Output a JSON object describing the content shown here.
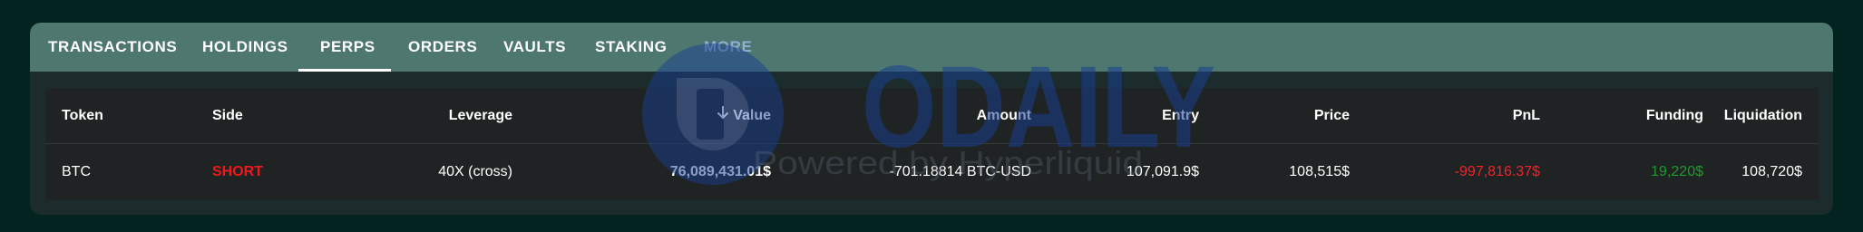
{
  "tabs": [
    {
      "label": "TRANSACTIONS"
    },
    {
      "label": "HOLDINGS"
    },
    {
      "label": "PERPS"
    },
    {
      "label": "ORDERS"
    },
    {
      "label": "VAULTS"
    },
    {
      "label": "STAKING"
    },
    {
      "label": "MORE"
    }
  ],
  "active_tab": "PERPS",
  "table": {
    "headers": {
      "token": "Token",
      "side": "Side",
      "leverage": "Leverage",
      "value": "Value",
      "amount": "Amount",
      "entry": "Entry",
      "price": "Price",
      "pnl": "PnL",
      "funding": "Funding",
      "liquidation": "Liquidation"
    },
    "rows": [
      {
        "token": "BTC",
        "side": "SHORT",
        "leverage": "40X (cross)",
        "value": "76,089,431.01$",
        "amount": "-701.18814 BTC-USD",
        "entry": "107,091.9$",
        "price": "108,515$",
        "pnl": "-997,816.37$",
        "funding": "19,220$",
        "liquidation": "108,720$"
      }
    ]
  },
  "watermark": {
    "logo_text": "ODAILY",
    "subtext": "Powered by Hyperliquid"
  },
  "colors": {
    "background": "#022320",
    "tab_bar": "#4e776f",
    "panel": "#1c2b2b",
    "table": "#202323",
    "short": "#f01818",
    "pnl_negative": "#f0232d",
    "funding_positive": "#1f9a2a",
    "more_tab": "#8fb0d6"
  }
}
